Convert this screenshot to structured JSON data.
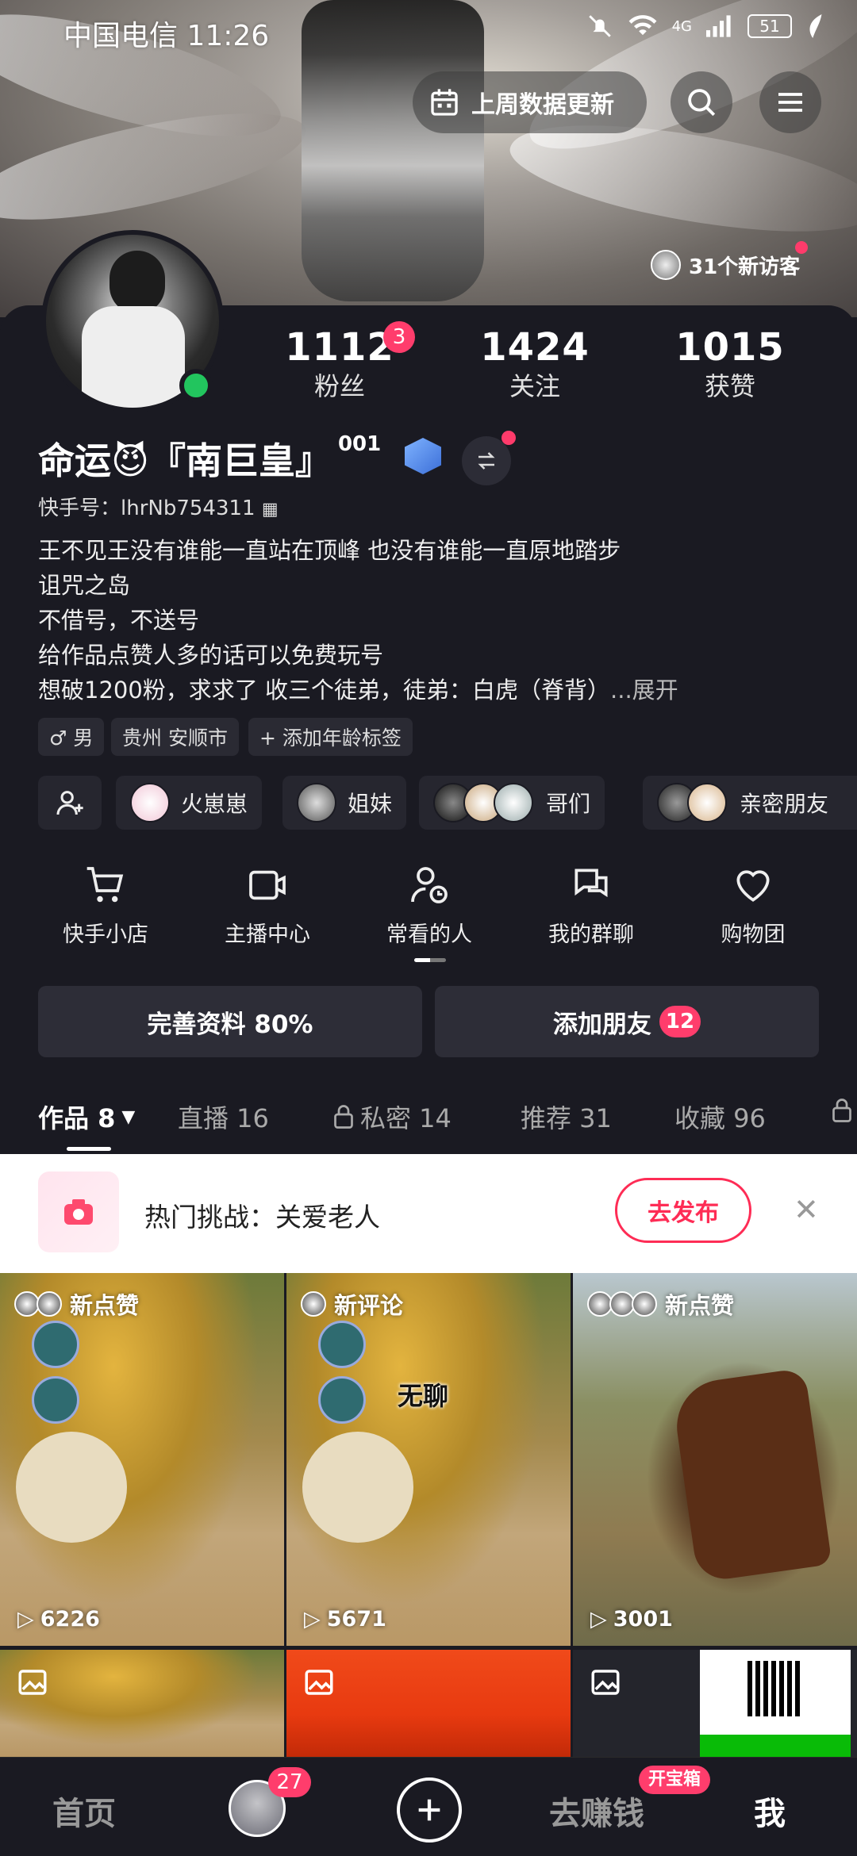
{
  "status_bar": {
    "carrier": "中国电信",
    "time": "11:26",
    "network": "4G",
    "battery": "51"
  },
  "header": {
    "update_label": "上周数据更新",
    "visitors_label": "31个新访客"
  },
  "stats": {
    "fans_count": "1112",
    "fans_label": "粉丝",
    "fans_badge": "3",
    "following_count": "1424",
    "following_label": "关注",
    "likes_count": "1015",
    "likes_label": "获赞"
  },
  "profile": {
    "name": "命运😈『南巨皇』",
    "name_sup": "001",
    "kuaishou_id": "快手号：lhrNb754311",
    "bio_lines": [
      "王不见王没有谁能一直站在顶峰 也没有谁能一直原地踏步",
      "诅咒之岛",
      "不借号，不送号",
      "给作品点赞人多的话可以免费玩号",
      "想破1200粉，求求了 收三个徒弟，徒弟：白虎（脊背）"
    ],
    "bio_more": "...展开",
    "tags": [
      "♂ 男",
      "贵州 安顺市",
      "+ 添加年龄标签"
    ]
  },
  "friend_groups": [
    "火崽崽",
    "姐妹",
    "哥们",
    "亲密朋友"
  ],
  "tools": [
    "快手小店",
    "主播中心",
    "常看的人",
    "我的群聊",
    "购物团"
  ],
  "actions": {
    "complete_profile": "完善资料 80%",
    "add_friends": "添加朋友",
    "add_friends_count": "12"
  },
  "tabs": [
    {
      "label": "作品 8",
      "active": true
    },
    {
      "label": "直播 16"
    },
    {
      "label": "私密 14",
      "locked": true
    },
    {
      "label": "推荐 31"
    },
    {
      "label": "收藏 96"
    }
  ],
  "challenge": {
    "text": "热门挑战：关爱老人",
    "button": "去发布"
  },
  "posts": [
    {
      "tag": "新点赞",
      "views": "6226",
      "overlay_text": ""
    },
    {
      "tag": "新评论",
      "views": "5671",
      "overlay_text": "无聊"
    },
    {
      "tag": "新点赞",
      "views": "3001",
      "overlay_text": ""
    }
  ],
  "bottom_nav": {
    "home": "首页",
    "avatar_badge": "27",
    "earn": "去赚钱",
    "treasure_badge": "开宝箱",
    "me": "我"
  },
  "colors": {
    "accent": "#fe2c55",
    "badge": "#ff3d6c",
    "online": "#22c55e",
    "background": "#1a1a22"
  }
}
